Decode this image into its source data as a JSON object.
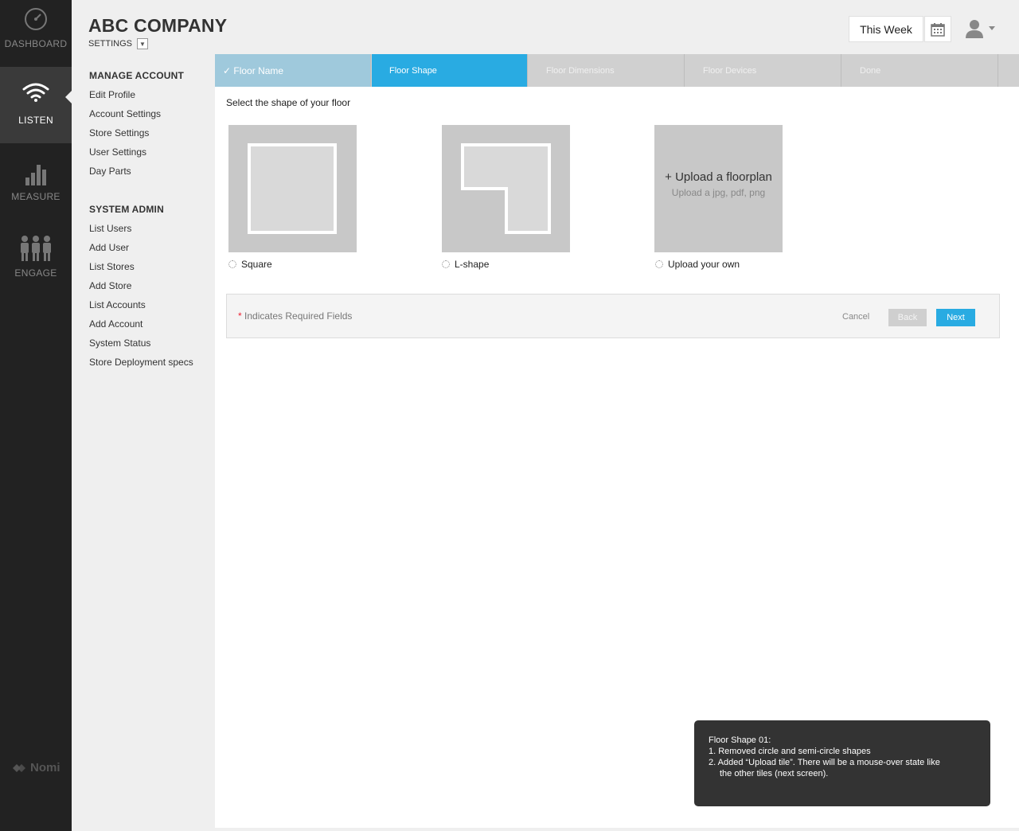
{
  "nav": {
    "items": [
      {
        "label": "DASHBOARD",
        "icon": "speedometer-icon"
      },
      {
        "label": "LISTEN",
        "icon": "wifi-icon"
      },
      {
        "label": "MEASURE",
        "icon": "bar-chart-icon"
      },
      {
        "label": "ENGAGE",
        "icon": "people-icon"
      }
    ],
    "brand": "Nomi"
  },
  "header": {
    "company": "ABC COMPANY",
    "section": "SETTINGS",
    "date_range": "This Week"
  },
  "sidebar": {
    "manage_title": "MANAGE ACCOUNT",
    "manage": [
      "Edit Profile",
      "Account Settings",
      "Store Settings",
      "User Settings",
      "Day Parts"
    ],
    "admin_title": "SYSTEM ADMIN",
    "admin": [
      "List Users",
      "Add User",
      "List Stores",
      "Add Store",
      "List Accounts",
      "Add Account",
      "System Status",
      "Store Deployment specs"
    ]
  },
  "wizard": {
    "steps": [
      {
        "label": "✓ Floor Name",
        "state": "done"
      },
      {
        "label": "Floor Shape",
        "state": "current"
      },
      {
        "label": "Floor Dimensions",
        "state": "pending"
      },
      {
        "label": "Floor Devices",
        "state": "pending"
      },
      {
        "label": "Done",
        "state": "pending"
      }
    ],
    "prompt": "Select the shape of your floor",
    "options": [
      {
        "label": "Square"
      },
      {
        "label": "L-shape"
      },
      {
        "label": "Upload your own"
      }
    ],
    "upload_title": "+ Upload a floorplan",
    "upload_sub": "Upload a jpg, pdf, png"
  },
  "form": {
    "required_star": "*",
    "required_text": "Indicates Required Fields",
    "cancel": "Cancel",
    "back": "Back",
    "next": "Next"
  },
  "note": {
    "title": "Floor Shape 01:",
    "line1": "1. Removed circle and semi-circle shapes",
    "line2": "2. Added “Upload tile”. There will be a mouse-over state like",
    "line3": "the other tiles (next screen)."
  },
  "colors": {
    "accent": "#29abe2",
    "done_step": "#9fc9dc",
    "nav_bg": "#222222"
  }
}
